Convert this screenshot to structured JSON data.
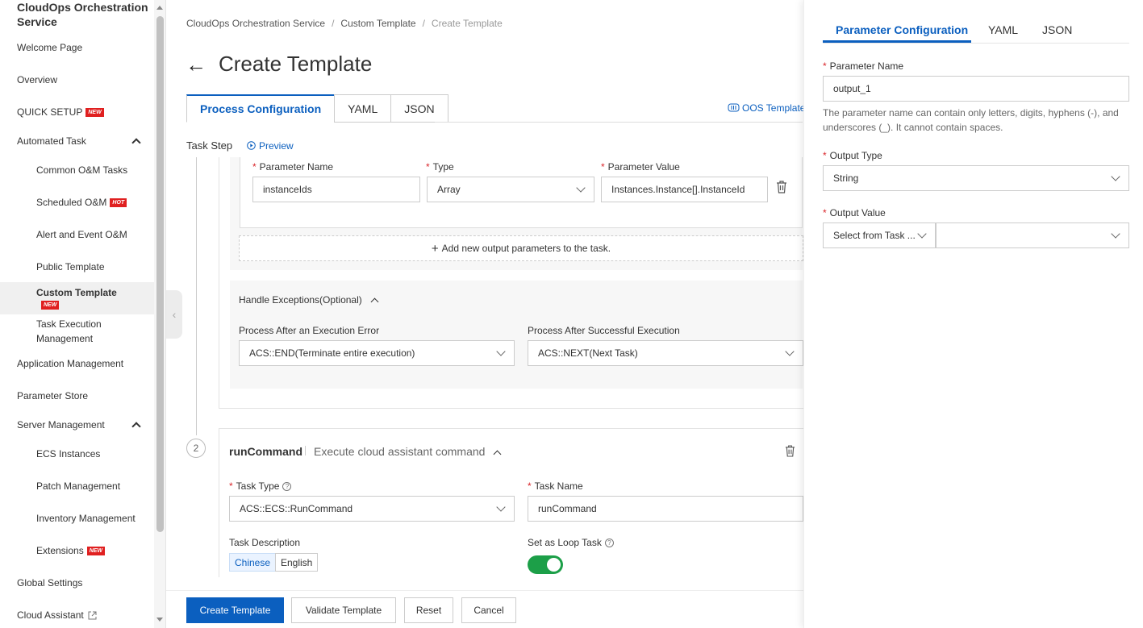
{
  "sidebar": {
    "title": "CloudOps Orchestration Service",
    "items": [
      {
        "label": "Welcome Page"
      },
      {
        "label": "Overview"
      },
      {
        "label": "QUICK SETUP",
        "badge": "NEW"
      },
      {
        "label": "Automated Task"
      },
      {
        "label": "Common O&M Tasks"
      },
      {
        "label": "Scheduled O&M",
        "badge": "HOT"
      },
      {
        "label": "Alert and Event O&M"
      },
      {
        "label": "Public Template"
      },
      {
        "label": "Custom Template",
        "badge": "NEW"
      },
      {
        "label": "Task Execution Management"
      },
      {
        "label": "Application Management"
      },
      {
        "label": "Parameter Store"
      },
      {
        "label": "Server Management"
      },
      {
        "label": "ECS Instances"
      },
      {
        "label": "Patch Management"
      },
      {
        "label": "Inventory Management"
      },
      {
        "label": "Extensions",
        "badge": "NEW"
      },
      {
        "label": "Global Settings"
      },
      {
        "label": "Cloud Assistant"
      }
    ]
  },
  "breadcrumb": [
    "CloudOps Orchestration Service",
    "Custom Template",
    "Create Template"
  ],
  "page_title": "Create Template",
  "tabs": [
    "Process Configuration",
    "YAML",
    "JSON"
  ],
  "oos_link": "OOS Template",
  "task_step_label": "Task Step",
  "preview_label": "Preview",
  "outputs": {
    "param_name_label": "Parameter Name",
    "type_label": "Type",
    "param_value_label": "Parameter Value",
    "param_name_value": "instanceIds",
    "type_value": "Array",
    "param_value_value": "Instances.Instance[].InstanceId",
    "add_label": "Add new output parameters to the task."
  },
  "exceptions": {
    "title": "Handle Exceptions(Optional)",
    "error_label": "Process After an Execution Error",
    "error_value": "ACS::END(Terminate entire execution)",
    "success_label": "Process After Successful Execution",
    "success_value": "ACS::NEXT(Next Task)"
  },
  "step2": {
    "number": "2",
    "name": "runCommand",
    "description": "Execute cloud assistant command",
    "task_type_label": "Task Type",
    "task_type_value": "ACS::ECS::RunCommand",
    "task_name_label": "Task Name",
    "task_name_value": "runCommand",
    "task_desc_label": "Task Description",
    "lang_chinese": "Chinese",
    "lang_english": "English",
    "loop_label": "Set as Loop Task",
    "loop_enabled": true
  },
  "footer": {
    "create": "Create Template",
    "validate": "Validate Template",
    "reset": "Reset",
    "cancel": "Cancel"
  },
  "panel": {
    "tabs": [
      "Parameter Configuration",
      "YAML",
      "JSON"
    ],
    "param_name_label": "Parameter Name",
    "param_name_value": "output_1",
    "param_name_hint": "The parameter name can contain only letters, digits, hyphens (-), and underscores (_). It cannot contain spaces.",
    "output_type_label": "Output Type",
    "output_type_value": "String",
    "output_value_label": "Output Value",
    "output_value_select": "Select from Task ...",
    "output_value_value": ""
  },
  "colors": {
    "accent": "#0b5fbf",
    "badge": "#e02020",
    "toggle_on": "#1c9f48",
    "required": "#d9262b"
  }
}
